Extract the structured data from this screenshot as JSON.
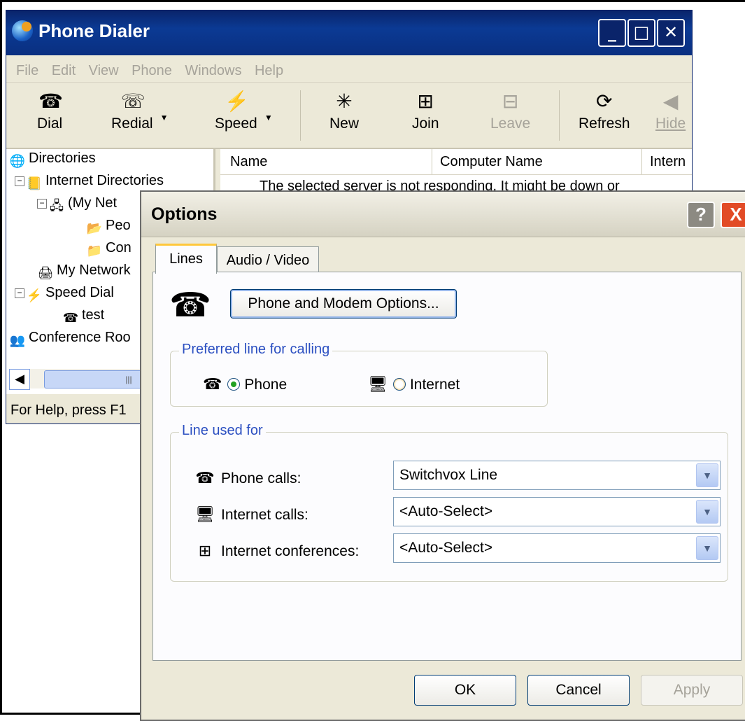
{
  "main_window": {
    "title": "Phone Dialer",
    "menu": [
      "File",
      "Edit",
      "View",
      "Phone",
      "Windows",
      "Help"
    ],
    "toolbar": {
      "dial": "Dial",
      "redial": "Redial",
      "speed": "Speed",
      "new": "New",
      "join": "Join",
      "leave": "Leave",
      "refresh": "Refresh",
      "hide": "Hide"
    },
    "tree": {
      "directories": "Directories",
      "internet_directories": "Internet Directories",
      "my_network_server": "(My Net",
      "people": "Peo",
      "conferences": "Con",
      "my_network": "My Network",
      "speed_dial": "Speed Dial",
      "test": "test",
      "conference_room": "Conference Roo"
    },
    "list": {
      "columns": [
        "Name",
        "Computer Name",
        "Intern"
      ],
      "message": "The selected server is not responding. It might be down or"
    },
    "status": "For Help, press F1"
  },
  "options_dialog": {
    "title": "Options",
    "help_glyph": "?",
    "close_glyph": "X",
    "tabs": [
      "Lines",
      "Audio / Video"
    ],
    "phone_modem_button": "Phone and Modem Options...",
    "preferred_line": {
      "legend": "Preferred line for calling",
      "phone": "Phone",
      "internet": "Internet",
      "selected": "Phone"
    },
    "line_used_for": {
      "legend": "Line used for",
      "rows": [
        {
          "label": "Phone calls:",
          "value": "Switchvox Line",
          "icon": "phone-icon"
        },
        {
          "label": "Internet calls:",
          "value": "<Auto-Select>",
          "icon": "computer-icon"
        },
        {
          "label": "Internet conferences:",
          "value": "<Auto-Select>",
          "icon": "conference-icon"
        }
      ]
    },
    "buttons": {
      "ok": "OK",
      "cancel": "Cancel",
      "apply": "Apply"
    }
  }
}
